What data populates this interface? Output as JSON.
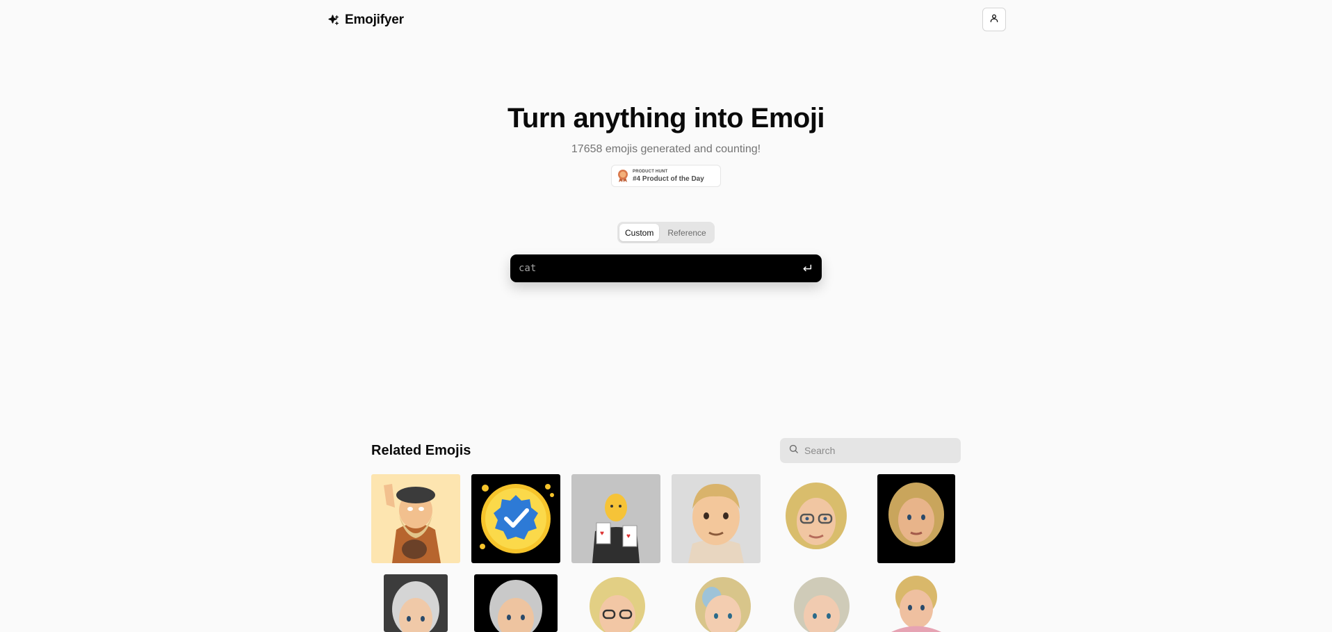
{
  "header": {
    "brand_name": "Emojifyer",
    "brand_icon": "sparkles-icon",
    "account_icon": "user-icon"
  },
  "hero": {
    "title": "Turn anything into Emoji",
    "subtitle": "17658 emojis generated and counting!",
    "badge_small": "PRODUCT HUNT",
    "badge_big": "#4 Product of the Day"
  },
  "modes": {
    "tabs": [
      "Custom",
      "Reference"
    ],
    "selected": "Custom"
  },
  "prompt": {
    "placeholder": "cat",
    "submit_icon": "enter-icon"
  },
  "related": {
    "title": "Related Emojis",
    "search_placeholder": "Search"
  },
  "colors": {
    "accent": "#000000",
    "page_bg": "#fafafa",
    "muted_text": "#737373"
  }
}
